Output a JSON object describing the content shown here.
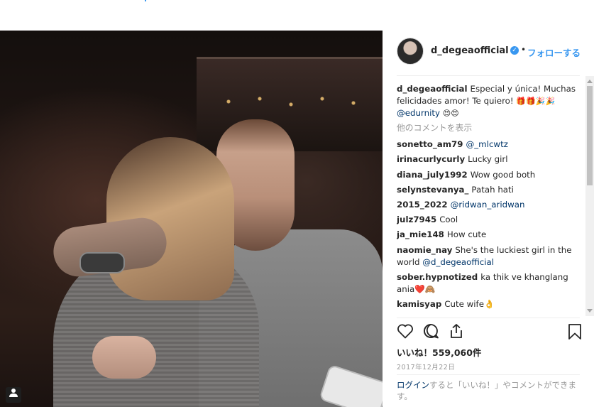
{
  "post": {
    "username": "d_degeaofficial",
    "verified_icon": "verified-badge-icon",
    "separator": "•",
    "follow_label": "フォローする",
    "caption": {
      "user": "d_degeaofficial",
      "text": "Especial y única! Muchas felicidades amor! Te quiero!",
      "emoji_a": "🎁🎁🎉🎉",
      "mention": "@edurnity",
      "emoji_b": "😍😍"
    },
    "more_comments": "他のコメントを表示",
    "comments": [
      {
        "user": "sonetto_am79",
        "text": "",
        "link": "@_mlcwtz"
      },
      {
        "user": "irinacurlycurly",
        "text": "Lucky girl",
        "link": ""
      },
      {
        "user": "diana_july1992",
        "text": "Wow good both",
        "link": ""
      },
      {
        "user": "selynstevanya_",
        "text": "Patah hati",
        "link": ""
      },
      {
        "user": "2015_2022",
        "text": "",
        "link": "@ridwan_aridwan"
      },
      {
        "user": "julz7945",
        "text": "Cool",
        "link": ""
      },
      {
        "user": "ja_mie148",
        "text": "How cute",
        "link": ""
      },
      {
        "user": "naomie_nay",
        "text": "She's the luckiest girl in the world",
        "link": "@d_degeaofficial"
      },
      {
        "user": "sober.hypnotized",
        "text": "ka thik ve khanglang ania❤️🙈",
        "link": ""
      },
      {
        "user": "kamisyap",
        "text": "Cute wife👌",
        "link": ""
      }
    ],
    "likes": "いいね！559,060件",
    "date": "2017年12月22日",
    "login_link": "ログイン",
    "login_text": "すると「いいね！」やコメントができます。",
    "icons": {
      "like": "heart-icon",
      "comment": "comment-icon",
      "share": "share-icon",
      "save": "bookmark-icon",
      "tag": "user-tag-icon"
    }
  }
}
